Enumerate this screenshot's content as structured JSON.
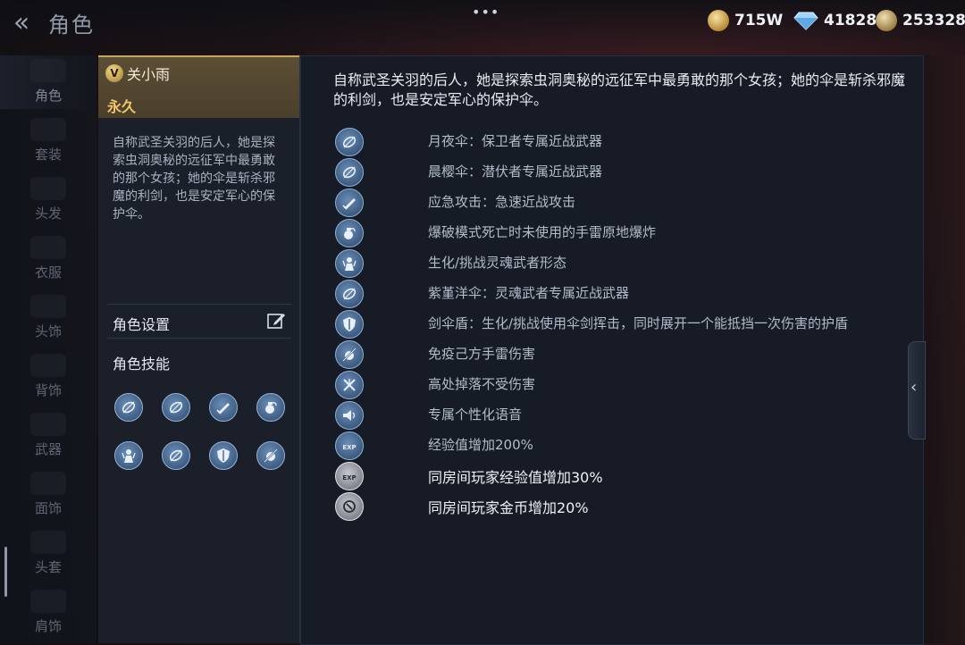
{
  "header": {
    "title": "角色",
    "menu_dots": "•••",
    "currencies": [
      {
        "name": "gold",
        "value": "715W"
      },
      {
        "name": "diamond",
        "value": "41828"
      },
      {
        "name": "coin",
        "value": "253328"
      }
    ]
  },
  "nav": {
    "items": [
      {
        "label": "角色",
        "active": true
      },
      {
        "label": "套装"
      },
      {
        "label": "头发"
      },
      {
        "label": "衣服"
      },
      {
        "label": "头饰"
      },
      {
        "label": "背饰"
      },
      {
        "label": "武器"
      },
      {
        "label": "面饰"
      },
      {
        "label": "头套"
      },
      {
        "label": "肩饰"
      }
    ]
  },
  "character": {
    "vip_badge": "V",
    "name": "关小雨",
    "duration": "永久",
    "description": "自称武圣关羽的后人，她是探索虫洞奥秘的远征军中最勇敢的那个女孩；她的伞是斩杀邪魔的利剑，也是安定军心的保护伞。",
    "settings_label": "角色设置",
    "skills_title": "角色技能",
    "skill_icons": [
      "umbrella-icon",
      "umbrella-icon",
      "knife-icon",
      "grenade-icon",
      "warrior-icon",
      "umbrella-icon",
      "shield-icon",
      "no-grenade-icon"
    ]
  },
  "detail": {
    "description": "自称武圣关羽的后人，她是探索虫洞奥秘的远征军中最勇敢的那个女孩；她的伞是斩杀邪魔的利剑，也是安定军心的保护伞。",
    "perks": [
      {
        "icon": "umbrella-icon",
        "text": "月夜伞：保卫者专属近战武器"
      },
      {
        "icon": "umbrella-icon",
        "text": "晨樱伞：潜伏者专属近战武器"
      },
      {
        "icon": "knife-icon",
        "text": "应急攻击：急速近战攻击"
      },
      {
        "icon": "grenade-icon",
        "text": "爆破模式死亡时未使用的手雷原地爆炸"
      },
      {
        "icon": "warrior-icon",
        "text": "生化/挑战灵魂武者形态"
      },
      {
        "icon": "umbrella-icon",
        "text": "紫堇洋伞：灵魂武者专属近战武器"
      },
      {
        "icon": "shield-icon",
        "text": "剑伞盾：生化/挑战使用伞剑挥击，同时展开一个能抵挡一次伤害的护盾"
      },
      {
        "icon": "no-grenade-icon",
        "text": "免疫己方手雷伤害"
      },
      {
        "icon": "no-fall-icon",
        "text": "高处掉落不受伤害"
      },
      {
        "icon": "voice-icon",
        "text": "专属个性化语音"
      },
      {
        "icon": "exp-icon",
        "text": "经验值增加200%",
        "icon_label": "EXP"
      },
      {
        "icon": "exp-room-icon",
        "text": "同房间玩家经验值增加30%",
        "icon_label": "EXP"
      },
      {
        "icon": "coin-room-icon",
        "text": "同房间玩家金币增加20%"
      }
    ]
  },
  "colors": {
    "accent_gold": "#f0c46b",
    "perk_icon_blue": "#3a577c",
    "panel_bg": "#161b25"
  }
}
